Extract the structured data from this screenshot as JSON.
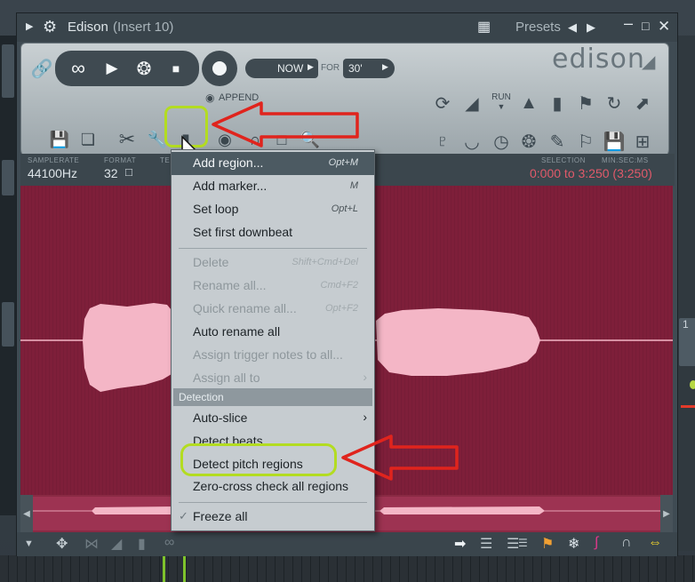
{
  "window": {
    "title": "Edison",
    "title_suffix": "(Insert 10)",
    "presets_label": "Presets",
    "logo": "edison"
  },
  "transport": {
    "now_label": "NOW",
    "for_label": "FOR",
    "duration_value": "30'",
    "append_label": "APPEND",
    "run_label": "RUN"
  },
  "info": {
    "samplerate_label": "SAMPLERATE",
    "samplerate_value": "44100Hz",
    "format_label": "FORMAT",
    "format_value": "32",
    "tempo_label": "TE",
    "selection_label": "SELECTION",
    "time_format_label": "MIN:SEC:MS",
    "selection_value": "0:000 to 3:250 (3:250)"
  },
  "menu": {
    "items": [
      {
        "label": "Add region...",
        "shortcut": "Opt+M",
        "enabled": true,
        "highlighted": true
      },
      {
        "label": "Add marker...",
        "shortcut": "M",
        "enabled": true
      },
      {
        "label": "Set loop",
        "shortcut": "Opt+L",
        "enabled": true
      },
      {
        "label": "Set first downbeat",
        "shortcut": "",
        "enabled": true
      },
      {
        "label": "Delete",
        "shortcut": "Shift+Cmd+Del",
        "enabled": false
      },
      {
        "label": "Rename all...",
        "shortcut": "Cmd+F2",
        "enabled": false
      },
      {
        "label": "Quick rename all...",
        "shortcut": "Opt+F2",
        "enabled": false
      },
      {
        "label": "Auto rename all",
        "shortcut": "",
        "enabled": true
      },
      {
        "label": "Assign trigger notes to all...",
        "shortcut": "",
        "enabled": false
      },
      {
        "label": "Assign all to",
        "shortcut": "",
        "enabled": false,
        "submenu": true
      },
      {
        "label": "Auto-slice",
        "shortcut": "",
        "enabled": true,
        "submenu": true
      },
      {
        "label": "Detect beats",
        "shortcut": "",
        "enabled": true
      },
      {
        "label": "Detect pitch regions",
        "shortcut": "",
        "enabled": true,
        "annotated": true
      },
      {
        "label": "Zero-cross check all regions",
        "shortcut": "",
        "enabled": true
      },
      {
        "label": "Freeze all",
        "shortcut": "",
        "enabled": true,
        "checked": true
      }
    ],
    "section_detection": "Detection"
  },
  "background": {
    "right_tab_text": "1"
  },
  "colors": {
    "accent_green": "#b3dc21",
    "annotation_red": "#e0241d",
    "waveform_bg": "#7e1f3a",
    "waveform": "#f4b6c6"
  }
}
